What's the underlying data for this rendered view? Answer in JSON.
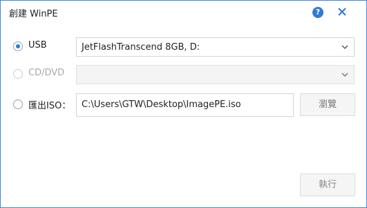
{
  "window": {
    "title": "創建 WinPE",
    "help_label": "?"
  },
  "options": {
    "usb": {
      "label": "USB",
      "checked": true,
      "device_value": "JetFlashTranscend 8GB, D:"
    },
    "cd_dvd": {
      "label": "CD/DVD",
      "enabled": false,
      "device_value": ""
    },
    "iso": {
      "label": "匯出ISO：",
      "path_value": "C:\\Users\\GTW\\Desktop\\ImagePE.iso",
      "browse_label": "瀏覽"
    }
  },
  "footer": {
    "execute_label": "執行"
  },
  "colors": {
    "accent": "#2e7bd6",
    "border": "#3c82e0"
  },
  "icons": {
    "help": "question-icon",
    "close": "close-icon",
    "dropdown": "chevron-down-icon"
  }
}
